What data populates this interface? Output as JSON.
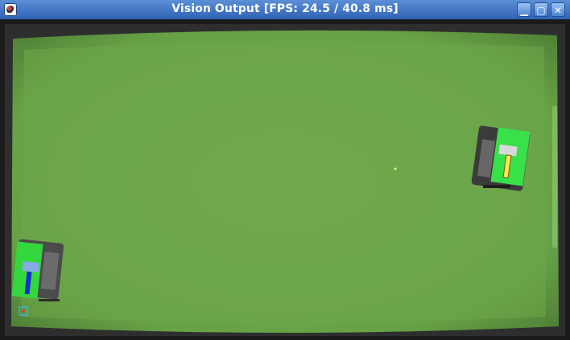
{
  "window": {
    "title": "Vision Output [FPS: 24.5 / 40.8 ms]",
    "controls": [
      "minimize",
      "maximize",
      "close"
    ]
  },
  "colors": {
    "titlebar": "#3b6fc1",
    "field": "#6fa94c",
    "field_edge": "#4f7f35",
    "robot_marker": "#38e04a",
    "robot_left_direction": "#1530c8",
    "robot_right_direction": "#ffe84a",
    "marker_square": "#39b3ff"
  },
  "scene": {
    "type": "top-down camera view of green soccer field with two robots",
    "robots": [
      {
        "name": "robot-left",
        "direction_color": "blue"
      },
      {
        "name": "robot-right",
        "direction_color": "yellow"
      }
    ]
  }
}
